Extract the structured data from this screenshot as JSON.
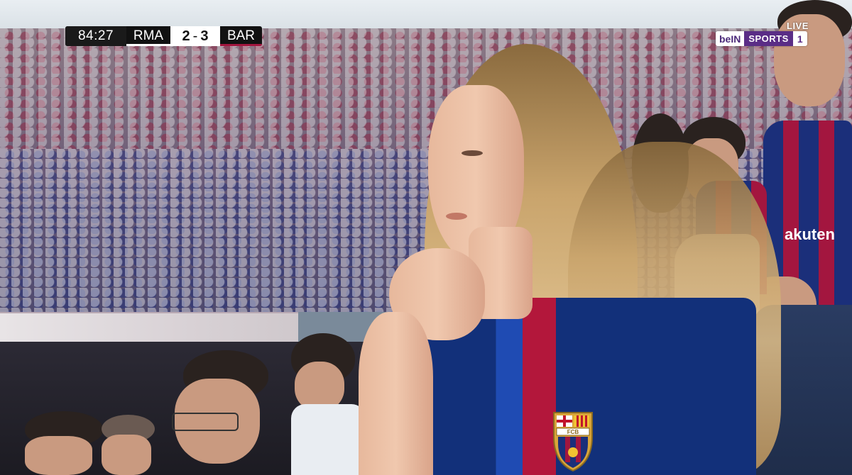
{
  "scoreboard": {
    "clock": "84:27",
    "home_team": "RMA",
    "away_team": "BAR",
    "home_score": "2",
    "separator": "-",
    "away_score": "3"
  },
  "broadcaster": {
    "live_label": "LIVE",
    "brand": "beIN",
    "channel": "SPORTS",
    "channel_number": "1"
  },
  "jersey_text": {
    "sponsor_partial": "akuten",
    "crest_letters": "FCB"
  },
  "colors": {
    "barca_blue": "#1b2f7a",
    "barca_garnet": "#a3163f",
    "bein_purple": "#5a2d86"
  }
}
